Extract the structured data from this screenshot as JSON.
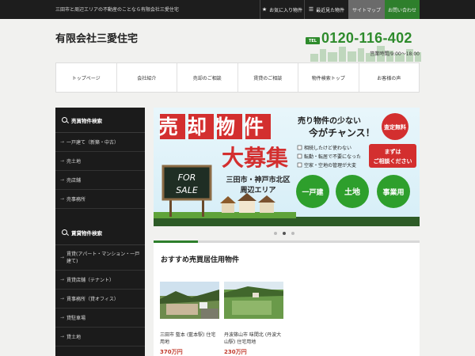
{
  "topbar": {
    "tagline": "三田市と周辺エリアの不動産のことなら有限会社三愛住宅",
    "favorites_label": "お気に入り物件",
    "recent_label": "最近見た物件",
    "sitemap_label": "サイトマップ",
    "contact_label": "お問い合わせ"
  },
  "header": {
    "company_name": "有限会社三愛住宅",
    "tel_badge": "TEL",
    "tel_number": "0120-116-402",
    "hours": "営業時間/9:00～18:00"
  },
  "nav": {
    "items": [
      "トップページ",
      "会社紹介",
      "売却のご相談",
      "賃貸のご相談",
      "物件検索トップ",
      "お客様の声"
    ]
  },
  "sidebar": {
    "sale_title": "売買物件検索",
    "sale_items": [
      "一戸建て（新築・中古）",
      "売土地",
      "売店舗",
      "売事務所"
    ],
    "rent_title": "賃貸物件検索",
    "rent_items": [
      "賃貸(アパート・マンション・一戸建て)",
      "賃貸店舗（テナント）",
      "賃事務所（貸オフィス）",
      "貸駐車場",
      "貸土地"
    ]
  },
  "banner": {
    "headline1": "売却物件",
    "headline2": "大募集",
    "catch1": "売り物件の少ない",
    "catch2": "今がチャンス！",
    "badge_free": "査定無料",
    "checks": [
      "相続したけど使わない",
      "転勤・転居で不要になった",
      "空家・空地の管理が大変"
    ],
    "cta1": "まずは",
    "cta2": "ご相談ください",
    "sign1": "FOR",
    "sign2": "SALE",
    "area1": "三田市・神戸市北区",
    "area2": "周辺エリア",
    "circles": [
      "一戸建",
      "土地",
      "事業用"
    ],
    "slide_count": 3,
    "active_slide": 2
  },
  "content": {
    "section_title": "おすすめ売買居住用物件",
    "cards": [
      {
        "address": "三田市 藍本 (藍本駅) 住宅用地",
        "price": "370万円"
      },
      {
        "address": "丹波篠山市 味間北 (丹波大山駅) 住宅用地",
        "price": "230万円"
      }
    ]
  },
  "colors": {
    "brand_green": "#2e8b2c",
    "banner_red": "#d32f2f",
    "price_red": "#c0392b"
  }
}
